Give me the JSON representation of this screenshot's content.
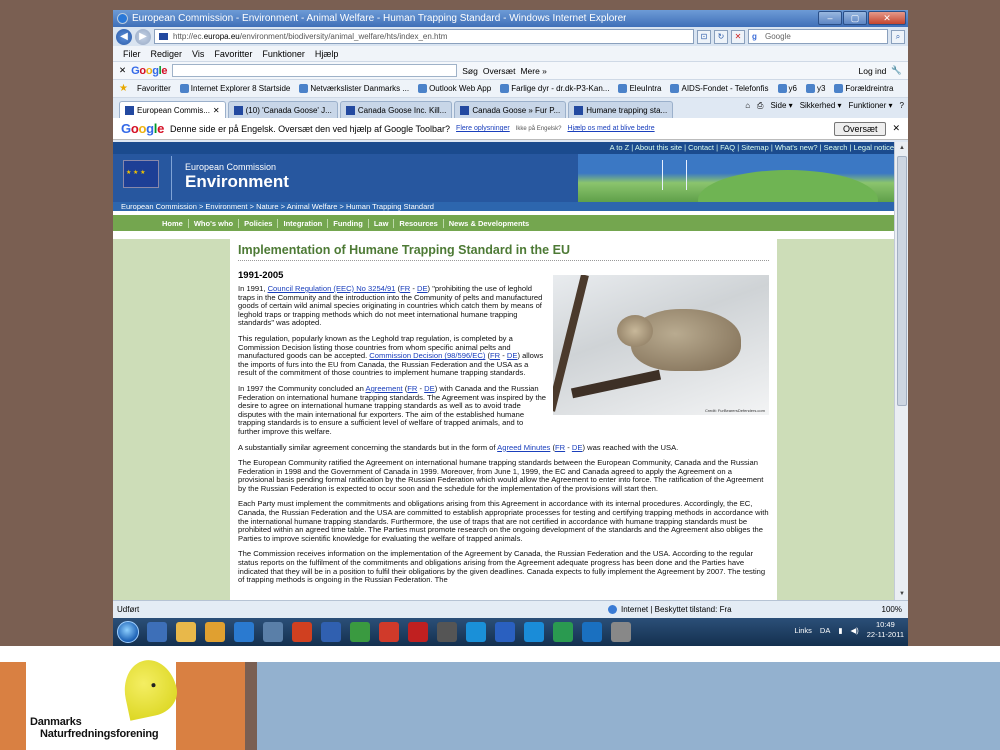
{
  "window": {
    "title": "European Commission - Environment - Animal Welfare - Human Trapping Standard - Windows Internet Explorer",
    "buttons": [
      "–",
      "▢",
      "✕"
    ]
  },
  "address": {
    "url_prefix": "http://ec.",
    "url_domain": "europa.eu",
    "url_rest": "/environment/biodiversity/animal_welfare/hts/index_en.htm",
    "search_placeholder": "Google"
  },
  "menu": [
    "Filer",
    "Rediger",
    "Vis",
    "Favoritter",
    "Funktioner",
    "Hjælp"
  ],
  "google_toolbar": {
    "logo": [
      "G",
      "o",
      "o",
      "g",
      "l",
      "e"
    ],
    "search_label": "Søg",
    "translate_label": "Oversæt",
    "more_label": "Mere »",
    "login_label": "Log ind"
  },
  "favorites": {
    "label": "Favoritter",
    "items": [
      "Internet Explorer 8 Startside",
      "Netværkslister Danmarks ...",
      "Outlook Web App",
      "Farlige dyr - dr.dk-P3-Kan...",
      "EleuIntra",
      "AIDS-Fondet - Telefonfis",
      "y6",
      "y3",
      "Forældreintra"
    ]
  },
  "tabs": [
    {
      "label": "European Commis...",
      "active": true
    },
    {
      "label": "(10) 'Canada Goose' J...",
      "active": false
    },
    {
      "label": "Canada Goose Inc. Kill...",
      "active": false
    },
    {
      "label": "Canada Goose » Fur P...",
      "active": false
    },
    {
      "label": "Humane trapping sta...",
      "active": false
    }
  ],
  "command_bar": [
    "Side ▾",
    "Sikkerhed ▾",
    "Funktioner ▾"
  ],
  "translate_bar": {
    "text": "Denne side er på Engelsk. Oversæt den ved hjælp af Google Toolbar?",
    "link": "Flere oplysninger",
    "question": "Ikke på Engelsk?",
    "help_link": "Hjælp os med at blive bedre",
    "button": "Oversæt"
  },
  "ec_site": {
    "top_links": "A to Z | About this site | Contact | FAQ | Sitemap | What's new? | Search | Legal notice",
    "subtitle": "European Commission",
    "title": "Environment",
    "breadcrumb": "European Commission  > Environment  > Nature  > Animal Welfare  > Human Trapping Standard",
    "nav": [
      "Home",
      "Who's who",
      "Policies",
      "Integration",
      "Funding",
      "Law",
      "Resources",
      "News & Developments"
    ]
  },
  "article": {
    "title": "Implementation of Humane Trapping Standard in the EU",
    "year_heading": "1991-2005",
    "photo_credit": "Credit: FurBearersDefenders.com",
    "p1_a": "In 1991, ",
    "p1_link": "Council Regulation (EEC) No 3254/91",
    "p1_fr": "FR",
    "p1_de": "DE",
    "p1_b": " \"prohibiting the use of leghold traps in the Community and the introduction into the Community of pelts and manufactured goods of certain wild animal species originating in countries which catch them by means of leghold traps or trapping methods which do not meet international humane trapping standards\" was adopted.",
    "p2_a": "This regulation, popularly known as the Leghold trap regulation, is completed by a Commission Decision listing those countries from whom specific animal pelts and manufactured goods can be accepted. ",
    "p2_link": "Commission Decision (98/596/EC)",
    "p2_fr": "FR",
    "p2_de": "DE",
    "p2_b": " allows the imports of furs into the EU from Canada, the Russian Federation and the USA as a result of the commitment of those countries to implement humane trapping standards.",
    "p3_a": "In 1997 the Community concluded an ",
    "p3_link": "Agreement",
    "p3_fr": "FR",
    "p3_de": "DE",
    "p3_b": " with Canada and the Russian Federation on international humane trapping standards. The Agreement was inspired by the desire to agree on international humane trapping standards as well as to avoid trade disputes with the main international fur exporters. The aim of the established humane trapping standards is to ensure a sufficient level of welfare of trapped animals, and to further improve this welfare.",
    "p4_a": "A substantially similar agreement concerning the standards but in the form of ",
    "p4_link": "Agreed Minutes",
    "p4_fr": "FR",
    "p4_de": "DE",
    "p4_b": " was reached with the USA.",
    "p5": "The European Community ratified the Agreement on international humane trapping standards between the European Community, Canada and the Russian Federation in 1998 and the Government of Canada in 1999. Moreover, from June 1, 1999, the EC and Canada agreed to apply the Agreement on a provisional basis pending formal ratification by the Russian Federation which would allow the Agreement to enter into force. The ratification of the Agreement by the Russian Federation is expected to occur soon and the schedule for the implementation of the provisions will start then.",
    "p6": "Each Party must implement the commitments and obligations arising from this Agreement in accordance with its internal procedures. Accordingly, the EC, Canada, the Russian Federation and the USA are committed to establish appropriate processes for testing and certifying trapping methods in accordance with the international humane trapping standards. Furthermore, the use of traps that are not certified in accordance with humane trapping standards must be prohibited within an agreed time table. The Parties must promote research on the ongoing development of the standards and the Agreement also obliges the Parties to improve scientific knowledge for evaluating the welfare of trapped animals.",
    "p7": "The Commission receives information on the implementation of the Agreement by Canada, the Russian Federation and the USA. According to the regular status reports on the fulfilment of the commitments and obligations arising from the Agreement adequate progress has been done and the Parties have indicated that they will be in a position to fulfil their obligations by the given deadlines. Canada expects to fully implement the Agreement by 2007. The testing of trapping methods is ongoing in the Russian Federation. The"
  },
  "status": {
    "left": "Udført",
    "zone": "Internet | Beskyttet tilstand: Fra",
    "zoom": "100%"
  },
  "taskbar": {
    "links": "Links",
    "lang": "DA",
    "time": "10:49",
    "date": "22-11-2011",
    "icon_colors": [
      "#3d6fb8",
      "#e8b84a",
      "#e0a030",
      "#2a7ad0",
      "#5a7fa8",
      "#d04020",
      "#3060b0",
      "#3a9a40",
      "#d03a2a",
      "#c02020",
      "#555555",
      "#1a90d8",
      "#2a60c0",
      "#1a8cd8",
      "#2a9a50",
      "#1a70c0",
      "#888888"
    ]
  },
  "footer": {
    "logo_line1": "Danmarks",
    "logo_line2": "Naturfredningsforening",
    "accent_orange": "#d98042",
    "accent_blue": "#93b1cf",
    "leaf_yellow": "#e6e030"
  }
}
